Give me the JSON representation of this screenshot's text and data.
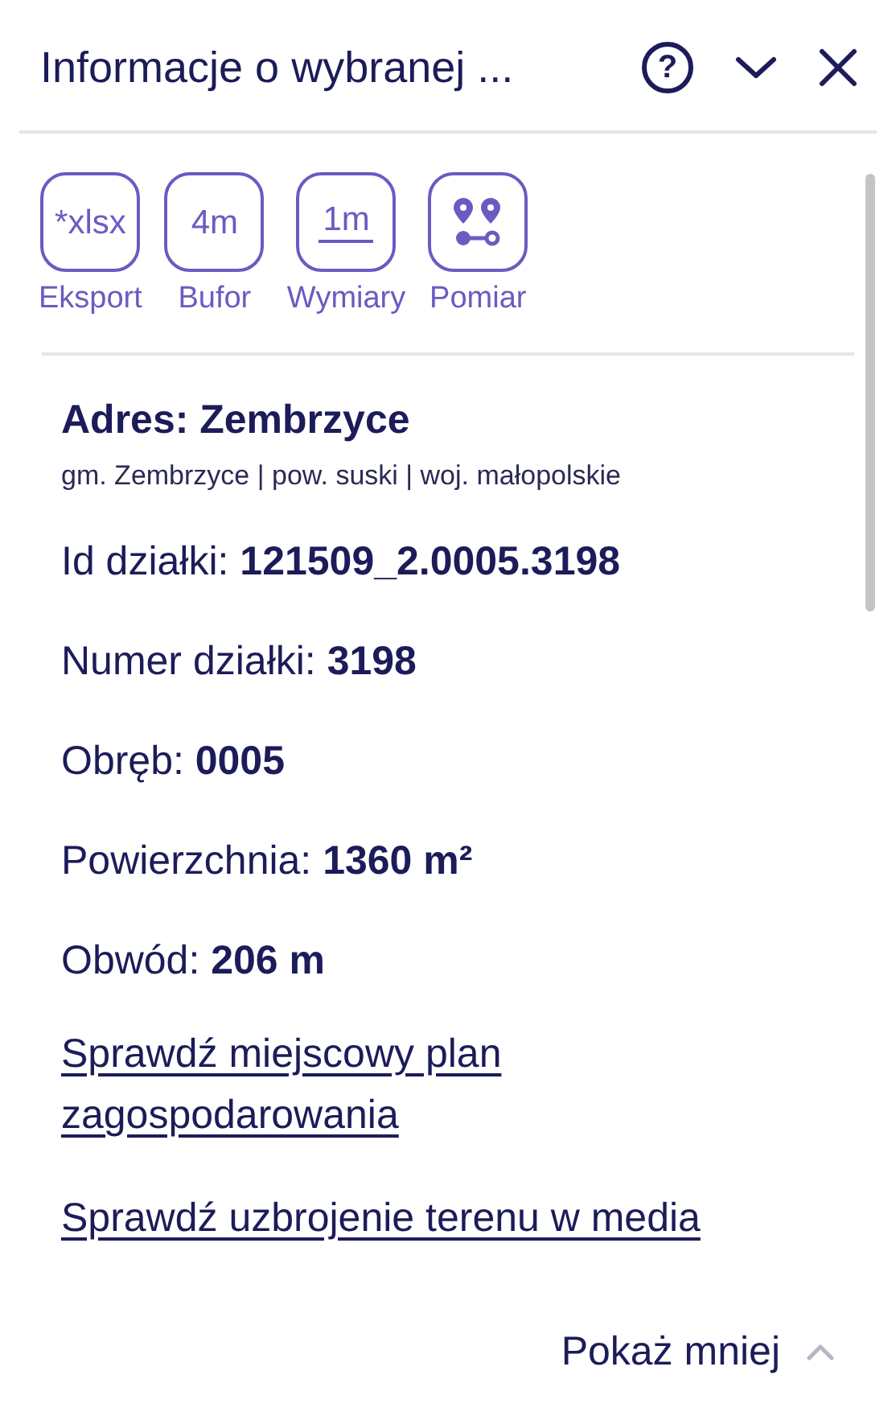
{
  "header": {
    "title": "Informacje o wybranej ...",
    "help_icon": "?"
  },
  "tools": [
    {
      "kind": "text",
      "icon_text": "*xlsx",
      "label": "Eksport",
      "underlined": false
    },
    {
      "kind": "text",
      "icon_text": "4m",
      "label": "Bufor",
      "underlined": false
    },
    {
      "kind": "text",
      "icon_text": "1m",
      "label": "Wymiary",
      "underlined": true
    },
    {
      "kind": "pins",
      "label": "Pomiar"
    }
  ],
  "address": {
    "title": "Adres: Zembrzyce",
    "details": "gm. Zembrzyce | pow. suski | woj. małopolskie"
  },
  "fields": [
    {
      "label": "Id działki:",
      "value": "121509_2.0005.3198"
    },
    {
      "label": "Numer działki:",
      "value": "3198"
    },
    {
      "label": "Obręb:",
      "value": "0005"
    },
    {
      "label": "Powierzchnia:",
      "value": "1360 m²"
    },
    {
      "label": "Obwód:",
      "value": "206 m"
    }
  ],
  "links": [
    "Sprawdź miejscowy plan zagospodarowania",
    "Sprawdź uzbrojenie terenu w media"
  ],
  "footer": {
    "toggle": "Pokaż mniej",
    "expanded": true
  }
}
